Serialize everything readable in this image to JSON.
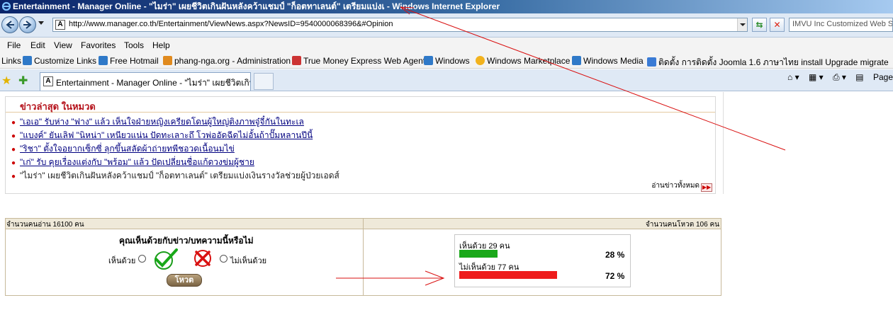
{
  "window": {
    "title": "Entertainment - Manager Online - \"ไมร่า\" เผยชีวิตเกินฝันหลังคว้าแชมป์ \"ก็อตทาเลนต์\" เตรียมแบ่งเ - Windows Internet Explorer"
  },
  "address": {
    "url": "http://www.manager.co.th/Entertainment/ViewNews.aspx?NewsID=9540000068396&#Opinion",
    "search_placeholder": "IMVU Inc Customized Web Search"
  },
  "menu": [
    "File",
    "Edit",
    "View",
    "Favorites",
    "Tools",
    "Help"
  ],
  "links_bar": {
    "label": "Links",
    "items": [
      "Customize Links",
      "Free Hotmail",
      "phang-nga.org - Administration",
      "True Money Express Web Agent",
      "Windows",
      "Windows Marketplace",
      "Windows Media",
      "ติดตั้ง การติดตั้ง Joomla 1.6 ภาษาไทย install Upgrade migrate"
    ]
  },
  "tab": {
    "title": "Entertainment - Manager Online - \"ไมร่า\" เผยชีวิตเกินฝั..."
  },
  "tools": {
    "page": "Page"
  },
  "latest": {
    "heading": "ข่าวล่าสุด ในหมวด",
    "items": [
      "\"เอเอ\" รับห่าง \"ฟาง\" แล้ว เห็นใจฝ่ายหญิงเครียดโดนผู้ใหญ่ติงภาพจู๋จี๋กันในทะเล",
      "\"แบงค์\" ยันเลิฟ \"นิหน่า\" เหนียวแน่น ปัดทะเลาะถึ โวพ่ออัดฉีดไม่อั้นถ้าปั๊มหลานปีนี้",
      "\"ริชา\" ตั้งใจอยากเซ็กซี่ ลุกขึ้นสลัดผ้าถ่ายทพีชอวดเนื้อนมไข่",
      "\"เก่\" รับ คุยเรื่องแต่งกับ \"พร้อม\" แล้ว ปัดเปลี่ยนชื่อแก้ดวงข่มผู้ชาย",
      "\"ไมร่า\" เผยชีวิตเกินฝันหลังคว้าแชมป์ \"ก็อตทาเลนต์\" เตรียมแบ่งเงินรางวัลช่วยผู้ป่วยเอดส์"
    ],
    "read_all": "อ่านข่าวทั้งหมด"
  },
  "poll": {
    "readers": "จำนวนคนอ่าน 16100 คน",
    "voters": "จำนวนคนโหวต 106 คน",
    "question": "คุณเห็นด้วยกับข่าว/บทความนี้หรือไม่",
    "agree_label": "เห็นด้วย",
    "disagree_label": "ไม่เห็นด้วย",
    "vote_button": "โหวต",
    "results": {
      "agree": {
        "label": "เห็นด้วย 29 คน",
        "percent": 28,
        "percent_text": "28 %",
        "color": "#1aa81a"
      },
      "disagree": {
        "label": "ไม่เห็นด้วย 77 คน",
        "percent": 72,
        "percent_text": "72 %",
        "color": "#ee1c1c"
      }
    }
  },
  "colors": {
    "title_gradient_start": "#0a246a",
    "heading_red": "#b5121b",
    "link_blue": "#000080",
    "annotation_red": "#d91010"
  }
}
